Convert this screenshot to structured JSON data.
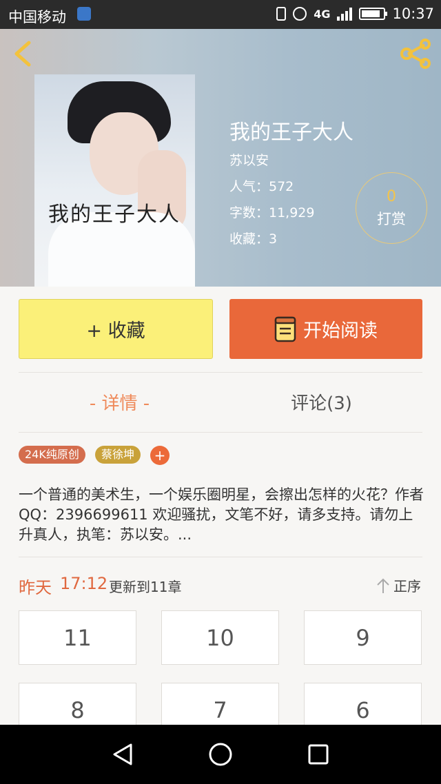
{
  "status_bar": {
    "carrier": "中国移动",
    "network": "4G",
    "time": "10:37"
  },
  "book": {
    "cover_title": "我的王子大人",
    "title": "我的王子大人",
    "author": "苏以安",
    "popularity": "人气：572",
    "word_count": "字数：11,929",
    "favorites": "收藏：3",
    "tip_count": "0",
    "tip_label": "打赏"
  },
  "actions": {
    "favorite_label": "+ 收藏",
    "read_label": "开始阅读"
  },
  "tabs": [
    {
      "label": "- 详情 -",
      "active": true
    },
    {
      "label": "评论(3)",
      "active": false
    }
  ],
  "tags": [
    "24K纯原创",
    "蔡徐坤"
  ],
  "tag_add": "+",
  "description": "一个普通的美术生，一个娱乐圈明星，会擦出怎样的火花？作者QQ：2396699611 欢迎骚扰，文笔不好，请多支持。请勿上升真人，执笔：苏以安。...",
  "update": {
    "day": "昨天",
    "time": "17:12",
    "text": "更新到11章",
    "sort_label": "正序"
  },
  "chapters": [
    "11",
    "10",
    "9",
    "8",
    "7",
    "6"
  ],
  "colors": {
    "accent": "#e9683a",
    "favorite_bg": "#fbf079",
    "tab_active": "#ef8a5a",
    "tip_gold": "#f4c44a"
  }
}
